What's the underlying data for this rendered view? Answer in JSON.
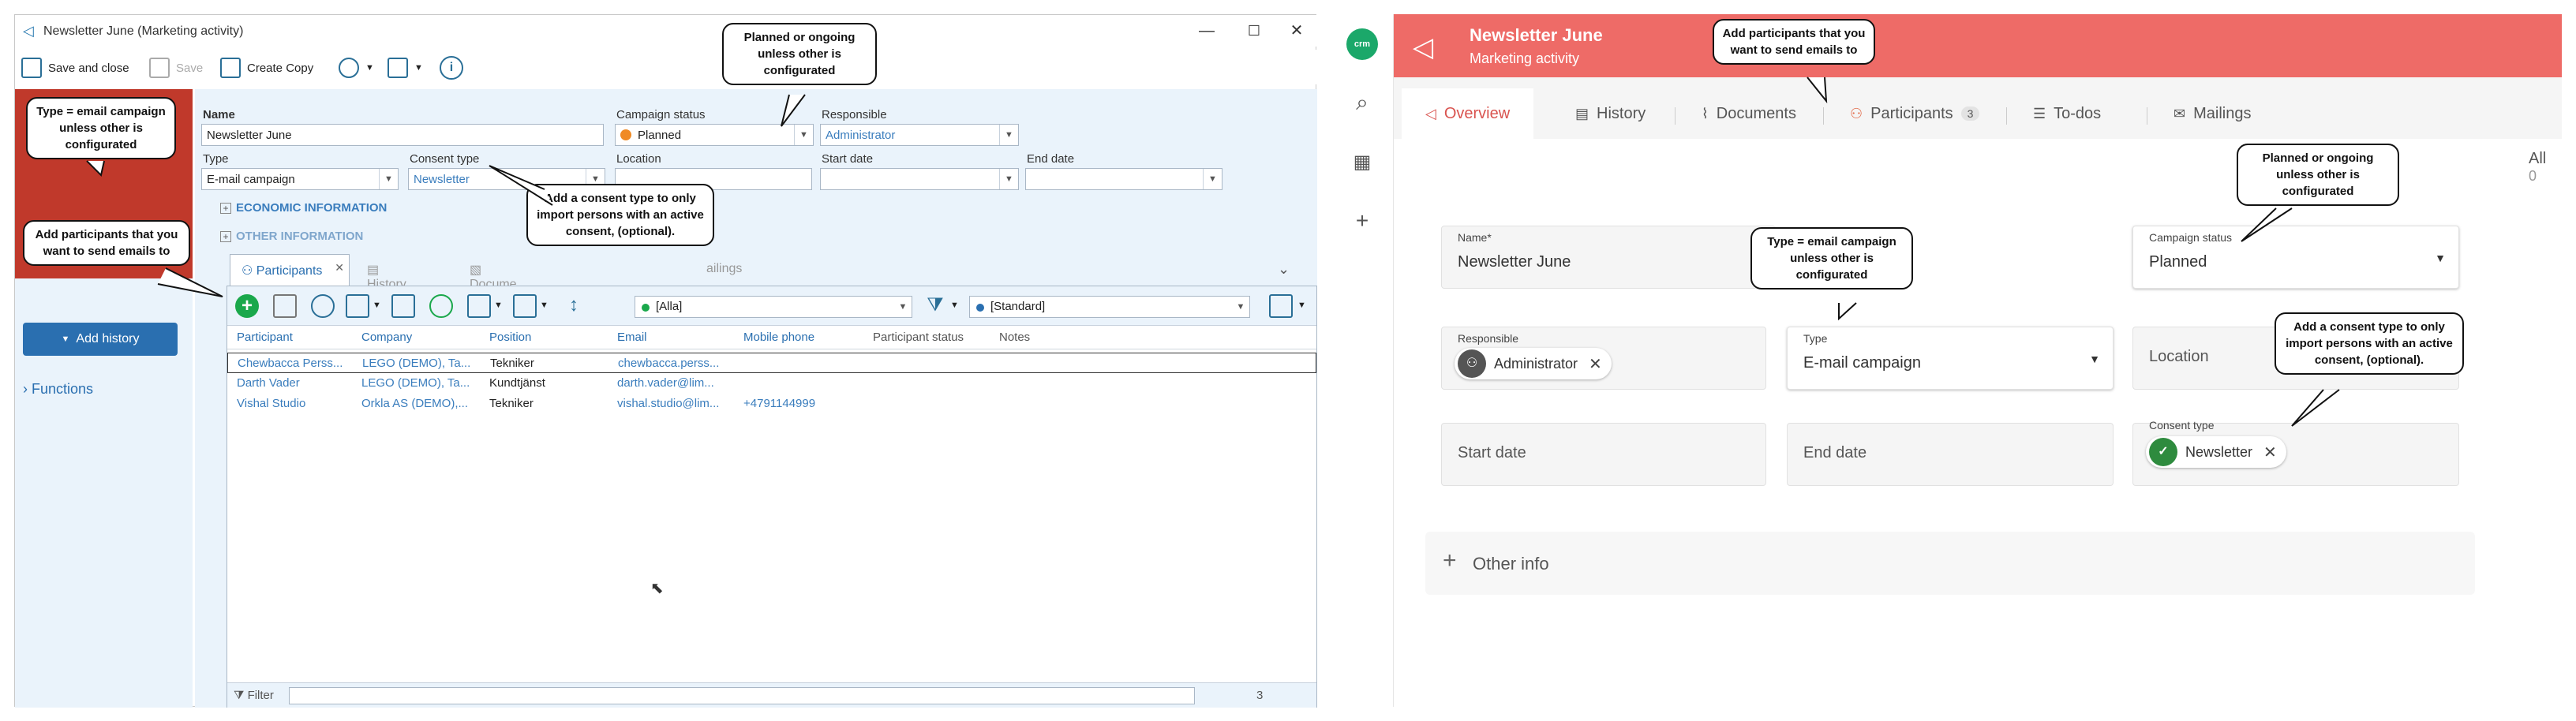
{
  "left": {
    "window_title": "Newsletter June (Marketing activity)",
    "window_controls": {
      "minimize": "—",
      "maximize": "☐",
      "close": "✕"
    },
    "toolbar": {
      "save_close": "Save and close",
      "save": "Save",
      "create_copy": "Create Copy"
    },
    "form": {
      "name_label": "Name",
      "name_value": "Newsletter June",
      "campaign_status_label": "Campaign status",
      "campaign_status_value": "Planned",
      "responsible_label": "Responsible",
      "responsible_value": "Administrator",
      "type_label": "Type",
      "type_value": "E-mail campaign",
      "consent_type_label": "Consent type",
      "consent_type_value": "Newsletter",
      "location_label": "Location",
      "start_date_label": "Start date",
      "end_date_label": "End date"
    },
    "sections": {
      "economic": "ECONOMIC INFORMATION",
      "other": "OTHER INFORMATION"
    },
    "tabs": {
      "participants": "Participants",
      "history": "History",
      "documents": "Docume",
      "mailings": "ailings"
    },
    "grid_toolbar": {
      "filter_all": "[Alla]",
      "view_standard": "[Standard]"
    },
    "grid": {
      "headers": [
        "Participant",
        "Company",
        "Position",
        "Email",
        "Mobile phone",
        "Participant status",
        "Notes"
      ],
      "rows": [
        {
          "participant": "Chewbacca Perss...",
          "company": "LEGO (DEMO), Ta...",
          "position": "Tekniker",
          "email": "chewbacca.perss...",
          "mobile": ""
        },
        {
          "participant": "Darth Vader",
          "company": "LEGO (DEMO), Ta...",
          "position": "Kundtjänst",
          "email": "darth.vader@lim...",
          "mobile": ""
        },
        {
          "participant": "Vishal Studio",
          "company": "Orkla AS (DEMO),...",
          "position": "Tekniker",
          "email": "vishal.studio@lim...",
          "mobile": "+4791144999"
        }
      ]
    },
    "filter_label": "Filter",
    "row_count": "3",
    "add_history": "Add history",
    "functions": "Functions",
    "callouts": {
      "type": "Type = email campaign unless other is configurated",
      "planned": "Planned or ongoing unless other is configurated",
      "participants": "Add participants that you want to send emails to",
      "consent": "Add a consent type to only import persons with an active consent, (optional)."
    }
  },
  "right": {
    "logo": "crm",
    "banner_title": "Newsletter June",
    "banner_subtitle": "Marketing activity",
    "tabs": [
      {
        "label": "Overview",
        "icon": "megaphone-icon"
      },
      {
        "label": "History",
        "icon": "history-icon"
      },
      {
        "label": "Documents",
        "icon": "paperclip-icon"
      },
      {
        "label": "Participants",
        "icon": "participants-icon",
        "badge": "3"
      },
      {
        "label": "To-dos",
        "icon": "checklist-icon"
      },
      {
        "label": "Mailings",
        "icon": "mail-icon"
      }
    ],
    "fields": {
      "name_label": "Name*",
      "name_value": "Newsletter June",
      "campaign_status_label": "Campaign status",
      "campaign_status_value": "Planned",
      "responsible_label": "Responsible",
      "responsible_value": "Administrator",
      "type_label": "Type",
      "type_value": "E-mail campaign",
      "location_placeholder": "Location",
      "start_date_placeholder": "Start date",
      "end_date_placeholder": "End date",
      "consent_type_label": "Consent type",
      "consent_type_value": "Newsletter"
    },
    "other_info": "Other info",
    "all_label": "All",
    "all_count": "0",
    "callouts": {
      "participants": "Add participants that you want to send emails to",
      "planned": "Planned or ongoing unless other is configurated",
      "type": "Type = email campaign unless other is configurated",
      "consent": "Add a consent type to only import persons with an active consent, (optional)."
    }
  },
  "colors": {
    "banner": "#ee6b67",
    "accent_blue": "#2a6fb0",
    "status_orange": "#f08a24",
    "add_green": "#1aa84b",
    "crm_green": "#1ba86a"
  }
}
